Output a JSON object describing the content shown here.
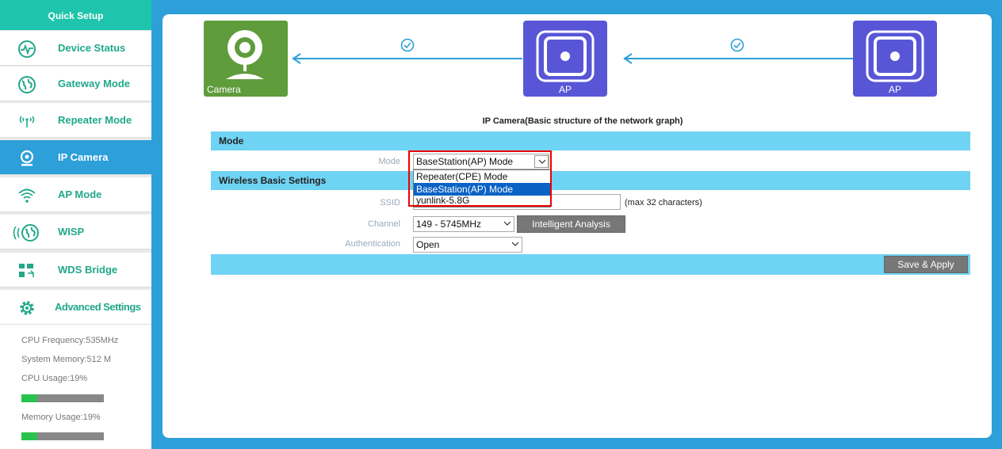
{
  "sidebar": {
    "header": "Quick Setup",
    "items": [
      {
        "label": "Device Status",
        "icon": "pulse-icon"
      },
      {
        "label": "Gateway Mode",
        "icon": "globe-icon"
      },
      {
        "label": "Repeater Mode",
        "icon": "antenna-icon"
      },
      {
        "label": "IP Camera",
        "icon": "camera-icon",
        "active": true
      },
      {
        "label": "AP Mode",
        "icon": "wifi-icon"
      },
      {
        "label": "WISP",
        "icon": "wisp-globe-icon"
      },
      {
        "label": "WDS Bridge",
        "icon": "bridge-icon"
      },
      {
        "label": "Advanced Settings",
        "icon": "gear-icon"
      }
    ],
    "stats": {
      "cpu_freq": "CPU Frequency:535MHz",
      "sys_mem": "System Memory:512 M",
      "cpu_usage": "CPU Usage:19%",
      "mem_usage": "Memory Usage:19%",
      "cpu_level": 0.19,
      "mem_level": 0.19
    }
  },
  "diagram": {
    "camera_label": "Camera",
    "ap1_label": "AP",
    "ap2_label": "AP",
    "title": "IP Camera(Basic structure of the network graph)"
  },
  "form": {
    "mode_section": "Mode",
    "mode_label": "Mode",
    "mode_value": "BaseStation(AP) Mode",
    "mode_options": [
      "Repeater(CPE) Mode",
      "BaseStation(AP) Mode"
    ],
    "wireless_section": "Wireless Basic Settings",
    "ssid_label": "SSID",
    "ssid_value": "yunlink-5.8G",
    "ssid_hint": "(max 32 characters)",
    "channel_label": "Channel",
    "channel_value": "149 - 5745MHz",
    "analysis_button": "Intelligent Analysis",
    "auth_label": "Authentication",
    "auth_value": "Open",
    "save_button": "Save & Apply"
  },
  "colors": {
    "accent_blue": "#2d9fd9",
    "teal": "#1ec4ab",
    "section_bar": "#6fd3f3",
    "ap_purple": "#5856d6",
    "camera_green": "#5f9c3c",
    "highlight_red": "#e00000"
  }
}
